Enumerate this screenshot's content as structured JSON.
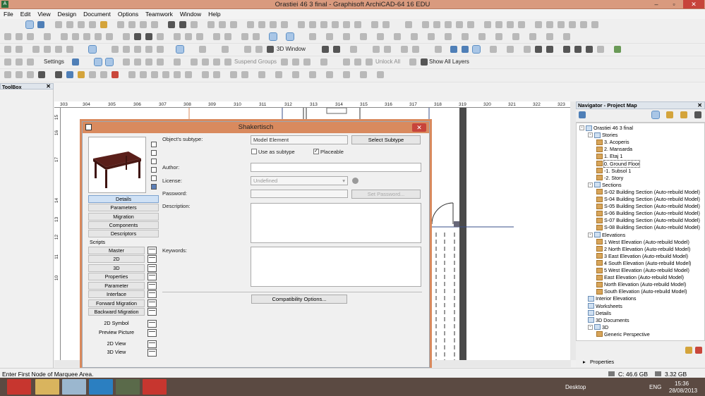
{
  "window": {
    "title": "Orastiei 46 3 final - Graphisoft ArchiCAD-64 16 EDU",
    "min": "–",
    "max": "▫",
    "close": "✕",
    "logo": "A"
  },
  "menu": [
    "File",
    "Edit",
    "View",
    "Design",
    "Document",
    "Options",
    "Teamwork",
    "Window",
    "Help"
  ],
  "toolbars": {
    "window_3d": "3D Window",
    "settings": "Settings",
    "suspend_groups": "Suspend Groups",
    "unlock_all": "Unlock All",
    "show_all_layers": "Show All Layers"
  },
  "toolbox": {
    "title": "ToolBox",
    "close": "✕"
  },
  "ruler_top": [
    "303",
    "304",
    "305",
    "306",
    "307",
    "308",
    "309",
    "310",
    "311",
    "312",
    "313",
    "314",
    "315",
    "316",
    "317",
    "318",
    "319",
    "320",
    "321",
    "322",
    "323"
  ],
  "ruler_left": [
    "15",
    "16",
    "17",
    "14",
    "13",
    "12",
    "11",
    "10"
  ],
  "dialog": {
    "title": "Shakertisch",
    "close": "✕",
    "object_subtype_label": "Object's subtype:",
    "object_subtype_value": "Model Element",
    "select_subtype": "Select Subtype",
    "use_as_subtype": "Use as subtype",
    "use_as_subtype_checked": "",
    "placeable": "Placeable",
    "placeable_checked": "✓",
    "author_label": "Author:",
    "author_value": "",
    "license_label": "License:",
    "license_value": "Undefined",
    "password_label": "Password:",
    "set_password": "Set Password...",
    "description_label": "Description:",
    "keywords_label": "Keywords:",
    "compat": "Compatibility Options...",
    "nav": [
      "Details",
      "Parameters",
      "Migration",
      "Components",
      "Descriptors"
    ],
    "scripts_label": "Scripts",
    "scripts": [
      "Master",
      "2D",
      "3D",
      "Properties",
      "Parameter",
      "Interface",
      "Forward Migration",
      "Backward Migration"
    ],
    "extras": [
      "2D Symbol",
      "Preview Picture",
      "2D View",
      "3D View"
    ]
  },
  "navigator": {
    "title": "Navigator - Project Map",
    "close": "✕",
    "items": [
      {
        "label": "Orastiei 46 3 final",
        "level": 0,
        "tw": "-",
        "type": "blue"
      },
      {
        "label": "Stories",
        "level": 1,
        "tw": "-",
        "type": "blue"
      },
      {
        "label": "3. Acoperis",
        "level": 2,
        "tw": "",
        "type": "story"
      },
      {
        "label": "2. Mansarda",
        "level": 2,
        "tw": "",
        "type": "story"
      },
      {
        "label": "1. Etaj 1",
        "level": 2,
        "tw": "",
        "type": "story"
      },
      {
        "label": "0. Ground Floor",
        "level": 2,
        "tw": "",
        "type": "story",
        "sel": true
      },
      {
        "label": "-1. Subsol 1",
        "level": 2,
        "tw": "",
        "type": "story"
      },
      {
        "label": "-2. Story",
        "level": 2,
        "tw": "",
        "type": "story"
      },
      {
        "label": "Sections",
        "level": 1,
        "tw": "-",
        "type": "blue"
      },
      {
        "label": "S-02 Building Section (Auto-rebuild Model)",
        "level": 2,
        "tw": "",
        "type": "story"
      },
      {
        "label": "S-04 Building Section (Auto-rebuild Model)",
        "level": 2,
        "tw": "",
        "type": "story"
      },
      {
        "label": "S-05 Building Section (Auto-rebuild Model)",
        "level": 2,
        "tw": "",
        "type": "story"
      },
      {
        "label": "S-06 Building Section (Auto-rebuild Model)",
        "level": 2,
        "tw": "",
        "type": "story"
      },
      {
        "label": "S-07 Building Section (Auto-rebuild Model)",
        "level": 2,
        "tw": "",
        "type": "story"
      },
      {
        "label": "S-08 Building Section (Auto-rebuild Model)",
        "level": 2,
        "tw": "",
        "type": "story"
      },
      {
        "label": "Elevations",
        "level": 1,
        "tw": "-",
        "type": "blue"
      },
      {
        "label": "1 West Elevation (Auto-rebuild Model)",
        "level": 2,
        "tw": "",
        "type": "story"
      },
      {
        "label": "2 North Elevation (Auto-rebuild Model)",
        "level": 2,
        "tw": "",
        "type": "story"
      },
      {
        "label": "3 East Elevation (Auto-rebuild Model)",
        "level": 2,
        "tw": "",
        "type": "story"
      },
      {
        "label": "4 South Elevation (Auto-rebuild Model)",
        "level": 2,
        "tw": "",
        "type": "story"
      },
      {
        "label": "5 West Elevation (Auto-rebuild Model)",
        "level": 2,
        "tw": "",
        "type": "story"
      },
      {
        "label": "East Elevation (Auto-rebuild Model)",
        "level": 2,
        "tw": "",
        "type": "story"
      },
      {
        "label": "North Elevation (Auto-rebuild Model)",
        "level": 2,
        "tw": "",
        "type": "story"
      },
      {
        "label": "South Elevation (Auto-rebuild Model)",
        "level": 2,
        "tw": "",
        "type": "story"
      },
      {
        "label": "Interior Elevations",
        "level": 1,
        "tw": "",
        "type": "blue"
      },
      {
        "label": "Worksheets",
        "level": 1,
        "tw": "",
        "type": "blue"
      },
      {
        "label": "Details",
        "level": 1,
        "tw": "",
        "type": "blue"
      },
      {
        "label": "3D Documents",
        "level": 1,
        "tw": "",
        "type": "blue"
      },
      {
        "label": "3D",
        "level": 1,
        "tw": "-",
        "type": "blue"
      },
      {
        "label": "Generic Perspective",
        "level": 2,
        "tw": "",
        "type": "story"
      }
    ],
    "properties": "Properties"
  },
  "status": {
    "hint": "Enter First Node of Marquee Area.",
    "disk_c": "C: 46.6 GB",
    "mem": "3.32 GB"
  },
  "taskbar": {
    "desktop": "Desktop",
    "lang": "ENG",
    "time": "15:36",
    "date": "28/08/2013"
  }
}
